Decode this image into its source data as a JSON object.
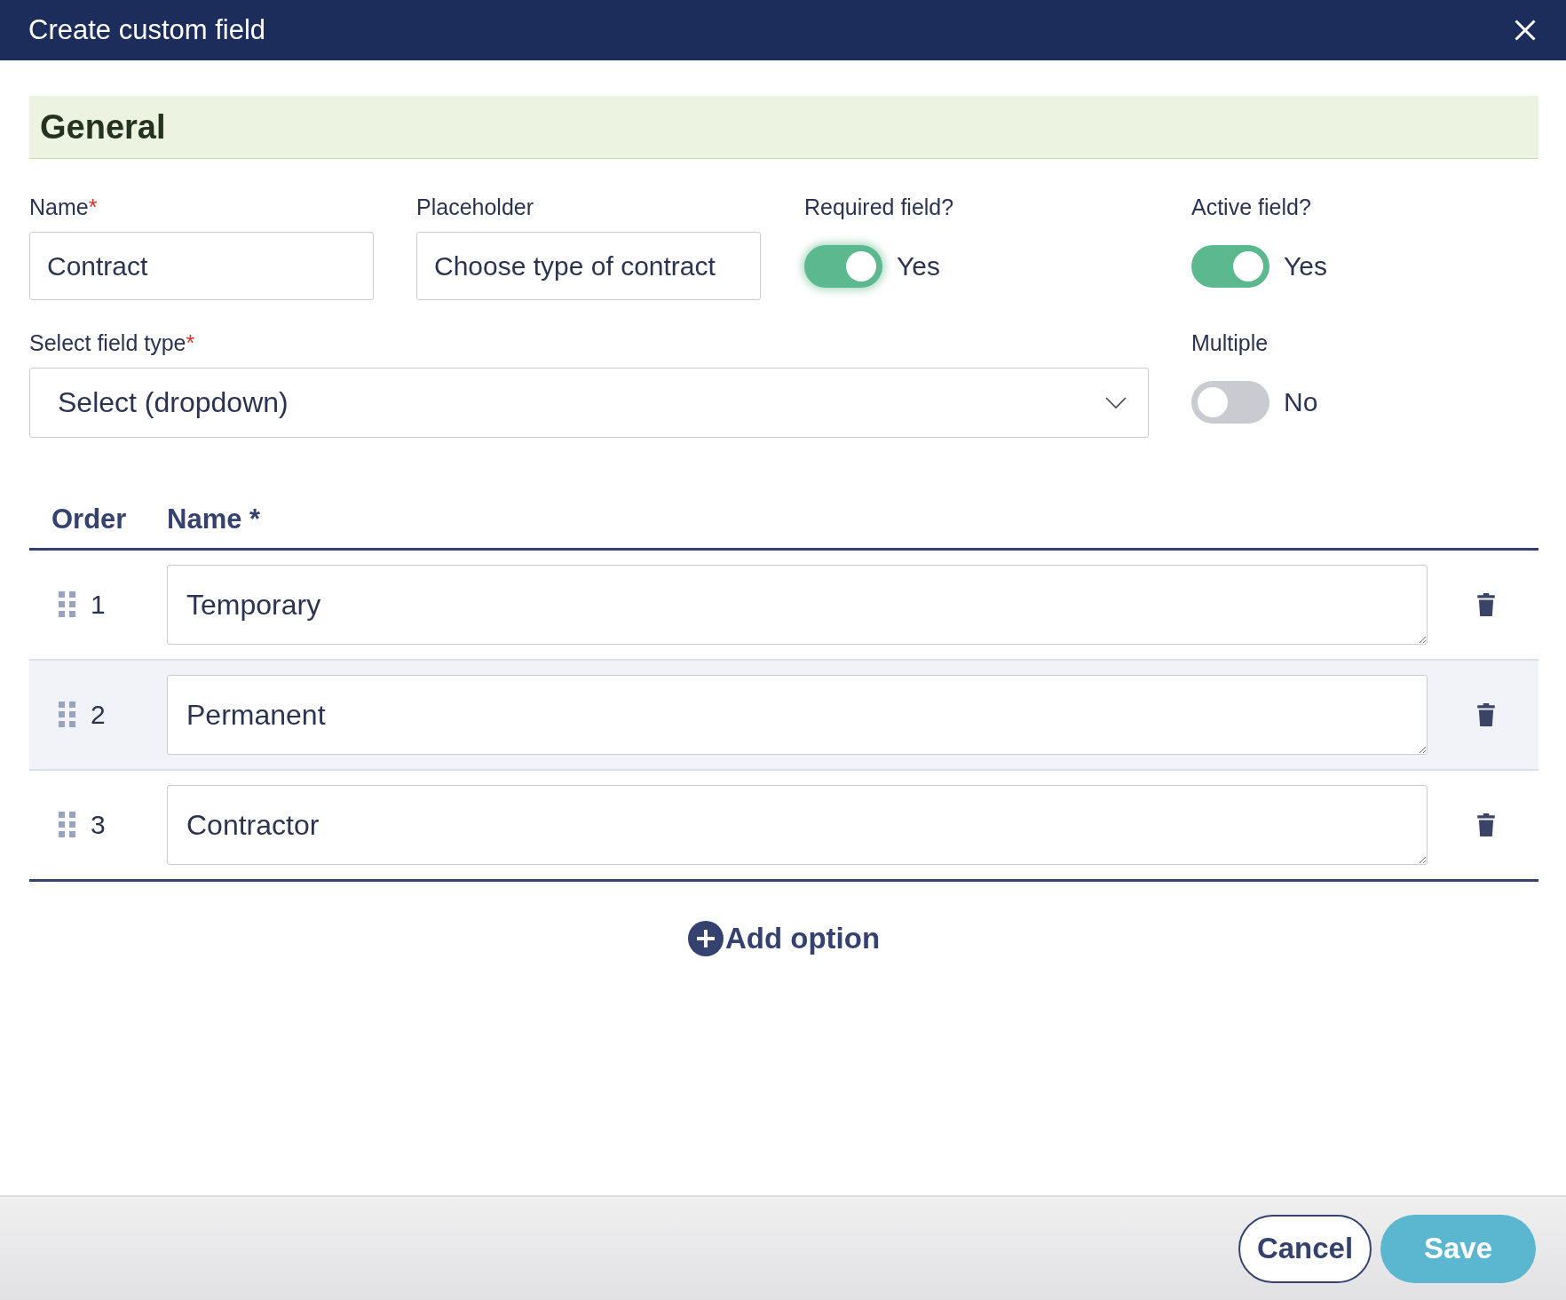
{
  "dialog": {
    "title": "Create custom field"
  },
  "section": {
    "title": "General"
  },
  "top_fields": [
    {
      "kind": "text",
      "label": "Name",
      "required_mark": "*",
      "value": "Contract"
    },
    {
      "kind": "text",
      "label": "Placeholder",
      "value": "Choose type of contract"
    },
    {
      "kind": "toggle",
      "label": "Required field?",
      "on": true,
      "state_text": "Yes"
    },
    {
      "kind": "toggle",
      "label": "Active field?",
      "on": true,
      "state_text": "Yes"
    }
  ],
  "field_type": {
    "label": "Select field type",
    "required_mark": "*",
    "value": "Select (dropdown)"
  },
  "multiple": {
    "label": "Multiple",
    "on": false,
    "state_text": "No"
  },
  "options_table": {
    "columns": [
      "Order",
      "Name *"
    ],
    "rows": [
      {
        "order": "1",
        "value": "Temporary",
        "selected": false
      },
      {
        "order": "2",
        "value": "Permanent",
        "selected": true
      },
      {
        "order": "3",
        "value": "Contractor",
        "selected": false
      }
    ]
  },
  "add_option": {
    "label": "Add option"
  },
  "buttons": [
    {
      "kind": "secondary",
      "label": "Cancel"
    },
    {
      "kind": "primary",
      "label": "Save"
    }
  ]
}
